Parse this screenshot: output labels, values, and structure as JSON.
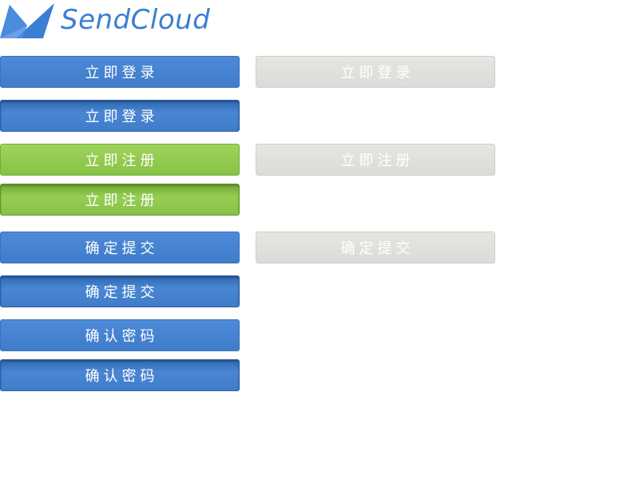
{
  "logo": {
    "text": "SendCloud",
    "brand_color": "#3a7fd1"
  },
  "colors": {
    "primary_blue": "#4584d2",
    "success_green": "#8fc94e",
    "disabled_gray": "#dfdedb"
  },
  "buttons": [
    {
      "label": "立即登录",
      "variant": "blue",
      "state": "normal"
    },
    {
      "label": "立即登录",
      "variant": "gray",
      "state": "disabled"
    },
    {
      "label": "立即登录",
      "variant": "blue",
      "state": "pressed"
    },
    {
      "label": "立即注册",
      "variant": "green",
      "state": "normal"
    },
    {
      "label": "立即注册",
      "variant": "gray",
      "state": "disabled"
    },
    {
      "label": "立即注册",
      "variant": "green",
      "state": "pressed"
    },
    {
      "label": "确定提交",
      "variant": "blue",
      "state": "normal"
    },
    {
      "label": "确定提交",
      "variant": "gray",
      "state": "disabled"
    },
    {
      "label": "确定提交",
      "variant": "blue",
      "state": "pressed"
    },
    {
      "label": "确认密码",
      "variant": "blue",
      "state": "normal"
    },
    {
      "label": "确认密码",
      "variant": "blue",
      "state": "pressed"
    }
  ]
}
